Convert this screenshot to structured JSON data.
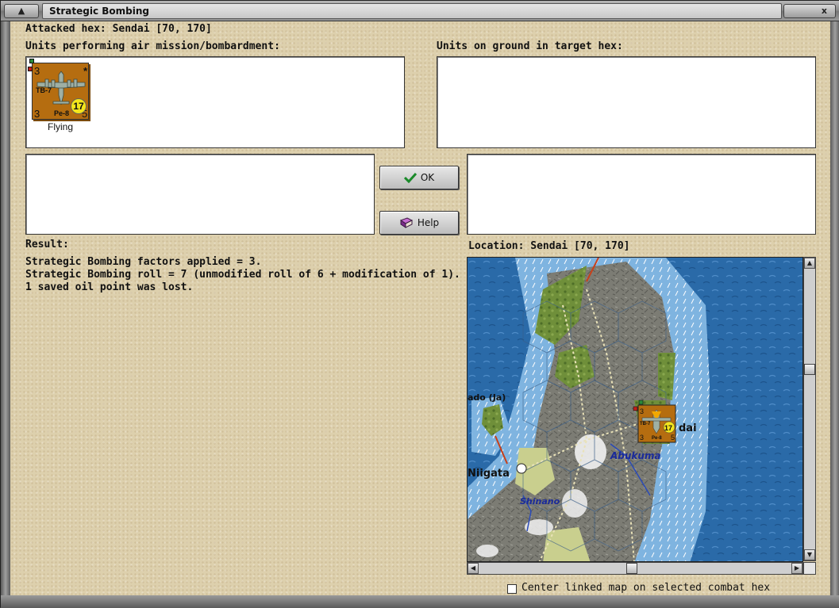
{
  "window": {
    "title": "Strategic Bombing",
    "close_glyph": "x"
  },
  "attacked_hex": "Attacked hex: Sendai  [70, 170]",
  "air_units_label": "Units performing air mission/bombardment:",
  "ground_units_label": "Units on ground in target hex:",
  "unit": {
    "top_left": "3",
    "bottom_left": "3",
    "bottom_right": "5",
    "code_left": "TB-7",
    "code_bottom": "Pe-8",
    "badge": "17",
    "star": "*",
    "status": "Flying"
  },
  "buttons": {
    "ok": "OK",
    "help": "Help"
  },
  "result": {
    "label": "Result:",
    "lines": [
      "Strategic Bombing factors applied = 3.",
      "Strategic Bombing roll = 7 (unmodified roll of 6 + modification of 1).",
      "1 saved oil point was lost."
    ]
  },
  "location_label": "Location:  Sendai  [70, 170]",
  "map": {
    "places": [
      "ado (Ja)",
      "Niigata",
      "dai",
      "Abukuma",
      "Shinano"
    ],
    "counter": {
      "top": "3",
      "bottom_left": "3",
      "bottom_right": "5",
      "code": "TB-7",
      "bottom_code": "Pe-8",
      "badge": "17"
    },
    "colors": {
      "sea": "#2a6aa8",
      "shallow": "#7fb4e0",
      "land": "#7c7c74",
      "forest": "#6f8f3a",
      "plain": "#c9cf8e"
    }
  },
  "center_map_label": "Center linked map on selected combat hex",
  "icons": [
    "window-menu-icon",
    "close-icon",
    "checkmark-icon",
    "help-book-icon",
    "scroll-up-icon",
    "scroll-down-icon",
    "scroll-left-icon",
    "scroll-right-icon",
    "city-icon"
  ]
}
